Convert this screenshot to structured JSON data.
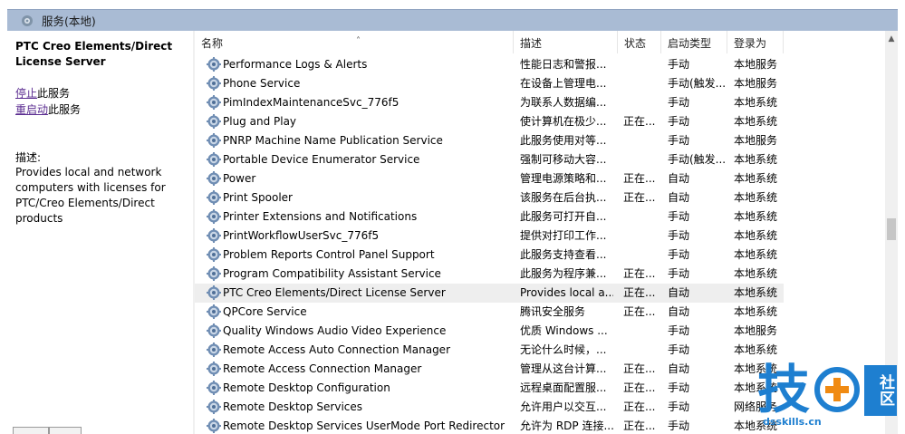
{
  "window": {
    "title": "服务(本地)",
    "icon": "services-gear-icon"
  },
  "left_pane": {
    "service_name": "PTC Creo Elements/Direct License Server",
    "actions": [
      {
        "link": "停止",
        "suffix": "此服务"
      },
      {
        "link": "重启动",
        "suffix": "此服务"
      }
    ],
    "description_label": "描述:",
    "description": "Provides local and network computers with licenses for PTC/Creo Elements/Direct products"
  },
  "table": {
    "columns": {
      "name": "名称",
      "description": "描述",
      "status": "状态",
      "startup_type": "启动类型",
      "log_on_as": "登录为"
    },
    "sort_indicator": "˄",
    "rows": [
      {
        "name": "Performance Logs & Alerts",
        "description": "性能日志和警报...",
        "status": "",
        "startup": "手动",
        "logon": "本地服务",
        "selected": false
      },
      {
        "name": "Phone Service",
        "description": "在设备上管理电...",
        "status": "",
        "startup": "手动(触发...",
        "logon": "本地服务",
        "selected": false
      },
      {
        "name": "PimIndexMaintenanceSvc_776f5",
        "description": "为联系人数据编...",
        "status": "",
        "startup": "手动",
        "logon": "本地系统",
        "selected": false
      },
      {
        "name": "Plug and Play",
        "description": "使计算机在极少...",
        "status": "正在...",
        "startup": "手动",
        "logon": "本地系统",
        "selected": false
      },
      {
        "name": "PNRP Machine Name Publication Service",
        "description": "此服务使用对等...",
        "status": "",
        "startup": "手动",
        "logon": "本地服务",
        "selected": false
      },
      {
        "name": "Portable Device Enumerator Service",
        "description": "强制可移动大容...",
        "status": "",
        "startup": "手动(触发...",
        "logon": "本地系统",
        "selected": false
      },
      {
        "name": "Power",
        "description": "管理电源策略和...",
        "status": "正在...",
        "startup": "自动",
        "logon": "本地系统",
        "selected": false
      },
      {
        "name": "Print Spooler",
        "description": "该服务在后台执...",
        "status": "正在...",
        "startup": "自动",
        "logon": "本地系统",
        "selected": false
      },
      {
        "name": "Printer Extensions and Notifications",
        "description": "此服务可打开自...",
        "status": "",
        "startup": "手动",
        "logon": "本地系统",
        "selected": false
      },
      {
        "name": "PrintWorkflowUserSvc_776f5",
        "description": "提供对打印工作...",
        "status": "",
        "startup": "手动",
        "logon": "本地系统",
        "selected": false
      },
      {
        "name": "Problem Reports Control Panel Support",
        "description": "此服务支持查看...",
        "status": "",
        "startup": "手动",
        "logon": "本地系统",
        "selected": false
      },
      {
        "name": "Program Compatibility Assistant Service",
        "description": "此服务为程序兼...",
        "status": "正在...",
        "startup": "手动",
        "logon": "本地系统",
        "selected": false
      },
      {
        "name": "PTC Creo Elements/Direct License Server",
        "description": "Provides local a...",
        "status": "正在...",
        "startup": "自动",
        "logon": "本地系统",
        "selected": true
      },
      {
        "name": "QPCore Service",
        "description": "腾讯安全服务",
        "status": "正在...",
        "startup": "自动",
        "logon": "本地系统",
        "selected": false
      },
      {
        "name": "Quality Windows Audio Video Experience",
        "description": "优质 Windows ...",
        "status": "",
        "startup": "手动",
        "logon": "本地服务",
        "selected": false
      },
      {
        "name": "Remote Access Auto Connection Manager",
        "description": "无论什么时候，...",
        "status": "",
        "startup": "手动",
        "logon": "本地系统",
        "selected": false
      },
      {
        "name": "Remote Access Connection Manager",
        "description": "管理从这台计算...",
        "status": "正在...",
        "startup": "自动",
        "logon": "本地系统",
        "selected": false
      },
      {
        "name": "Remote Desktop Configuration",
        "description": "远程桌面配置服...",
        "status": "正在...",
        "startup": "手动",
        "logon": "本地系统",
        "selected": false
      },
      {
        "name": "Remote Desktop Services",
        "description": "允许用户以交互...",
        "status": "正在...",
        "startup": "手动",
        "logon": "网络服务",
        "selected": false
      },
      {
        "name": "Remote Desktop Services UserMode Port Redirector",
        "description": "允许为 RDP 连接...",
        "status": "正在...",
        "startup": "手动",
        "logon": "本地系统",
        "selected": false
      }
    ]
  },
  "colors": {
    "titlebar": "#a9bbd4",
    "selected_row": "#eeeeee",
    "link": "#5b2d91",
    "watermark_blue": "#1e7fd0",
    "watermark_orange": "#f08a12"
  },
  "watermark": {
    "char": "技",
    "box_text": "社区",
    "url": "dsskills.cn"
  }
}
